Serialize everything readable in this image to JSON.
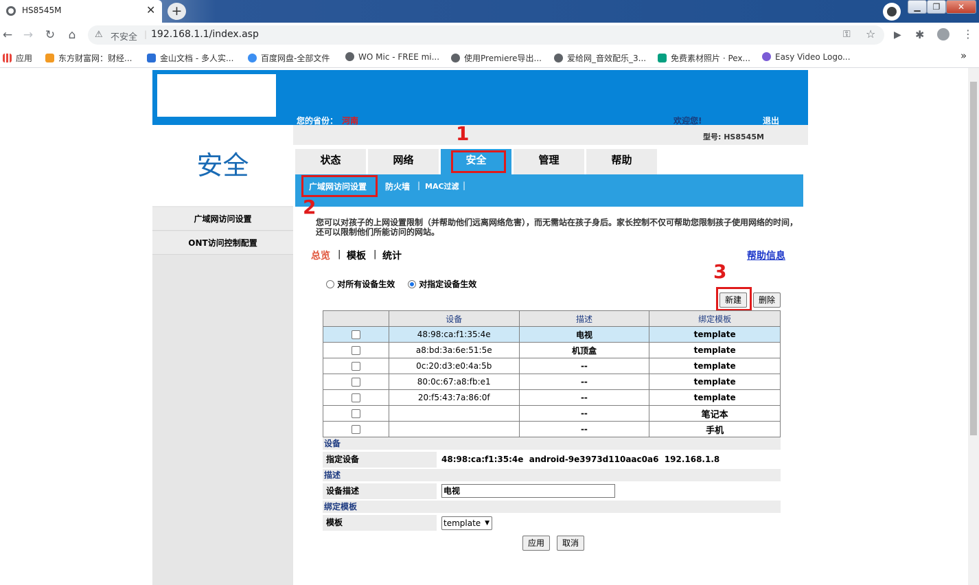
{
  "browser": {
    "tab_title": "HS8545M",
    "insecure_label": "不安全",
    "url": "192.168.1.1/index.asp",
    "bookmarks": [
      "应用",
      "东方财富网：财经...",
      "金山文档 - 多人实...",
      "百度网盘-全部文件",
      "WO Mic - FREE mi...",
      "使用Premiere导出...",
      "爱给网_音效配乐_3...",
      "免费素材照片 · Pex...",
      "Easy Video Logo..."
    ],
    "more": "»"
  },
  "header": {
    "province_label": "您的省份：",
    "province_value": "河南",
    "welcome": "欢迎您!",
    "logout": "退出",
    "model": "型号: HS8545M"
  },
  "sidebar": {
    "section_title": "安全",
    "items": [
      "广域网访问设置",
      "ONT访问控制配置"
    ]
  },
  "tabs": [
    "状态",
    "网络",
    "安全",
    "管理",
    "帮助"
  ],
  "subnav": [
    "广域网访问设置",
    "防火墙",
    "MAC过滤"
  ],
  "annotations": [
    "1",
    "2",
    "3"
  ],
  "main": {
    "description": "您可以对孩子的上网设置限制（并帮助他们远离网络危害），而无需站在孩子身后。家长控制不仅可帮助您限制孩子使用网络的时间，还可以限制他们所能访问的网站。",
    "view_tabs": [
      "总览",
      "模板",
      "统计"
    ],
    "help_link": "帮助信息",
    "radio_all": "对所有设备生效",
    "radio_specified": "对指定设备生效",
    "new_button": "新建",
    "delete_button": "删除",
    "table": {
      "headers": [
        "设备",
        "描述",
        "绑定模板"
      ],
      "rows": [
        {
          "device": "48:98:ca:f1:35:4e",
          "desc": "电视",
          "template": "template"
        },
        {
          "device": "a8:bd:3a:6e:51:5e",
          "desc": "机顶盒",
          "template": "template"
        },
        {
          "device": "0c:20:d3:e0:4a:5b",
          "desc": "--",
          "template": "template"
        },
        {
          "device": "80:0c:67:a8:fb:e1",
          "desc": "--",
          "template": "template"
        },
        {
          "device": "20:f5:43:7a:86:0f",
          "desc": "--",
          "template": "template"
        },
        {
          "device": "",
          "desc": "--",
          "template": "笔记本"
        },
        {
          "device": "",
          "desc": "--",
          "template": "手机"
        }
      ]
    },
    "form": {
      "device_section": "设备",
      "device_label": "指定设备",
      "device_value": "48:98:ca:f1:35:4e  android-9e3973d110aac0a6  192.168.1.8",
      "desc_section": "描述",
      "desc_label": "设备描述",
      "desc_value": "电视",
      "template_section": "绑定模板",
      "template_label": "模板",
      "template_value": "template",
      "apply_button": "应用",
      "cancel_button": "取消"
    }
  },
  "colors": {
    "header_blue": "#0784d8",
    "subnav_blue": "#2b9fe0",
    "annotation_red": "#e01b1b",
    "selected_row": "#cde8f7"
  }
}
